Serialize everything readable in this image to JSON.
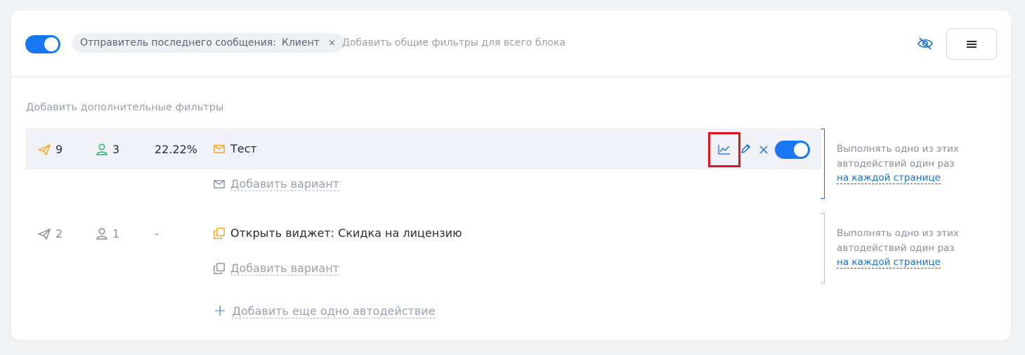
{
  "header": {
    "toggle_on": true,
    "filter_chip": {
      "label": "Отправитель последнего сообщения:",
      "value": "Клиент",
      "remove": "×"
    },
    "add_filters_placeholder": "Добавить общие фильтры для всего блока"
  },
  "add_extra_filters": "Добавить дополнительные фильтры",
  "actions": [
    {
      "sent": "9",
      "users": "3",
      "conversion": "22.22%",
      "title": "Тест",
      "icon": "mail-icon",
      "add_variant": "Добавить вариант",
      "enabled": true
    },
    {
      "sent": "2",
      "users": "1",
      "conversion": "-",
      "title": "Открыть виджет: Скидка на лицензию",
      "icon": "widget-icon",
      "add_variant": "Добавить вариант"
    }
  ],
  "side_note": {
    "line1": "Выполнять одно из этих",
    "line2": "автодействий один раз",
    "link": "на каждой странице"
  },
  "add_action": "Добавить еще одно автодействие",
  "colors": {
    "accent": "#1877f2",
    "link": "#1a6fd1",
    "highlight": "#e0141e",
    "orange": "#f5a623",
    "green": "#2bb673"
  }
}
